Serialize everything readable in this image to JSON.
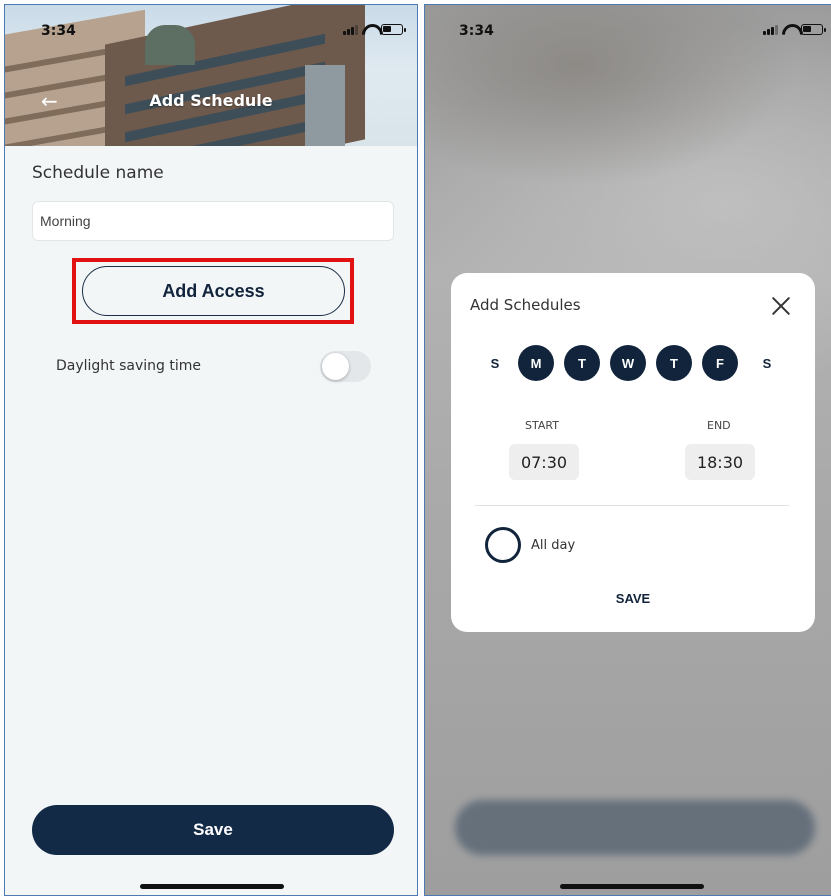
{
  "left": {
    "status": {
      "time": "3:34"
    },
    "header": {
      "title": "Add Schedule"
    },
    "schedule_name": {
      "label": "Schedule name",
      "value": "Morning"
    },
    "add_access": {
      "label": "Add Access"
    },
    "dst": {
      "label": "Daylight saving time",
      "enabled": false
    },
    "save": {
      "label": "Save"
    }
  },
  "right": {
    "status": {
      "time": "3:34"
    },
    "modal": {
      "title": "Add Schedules",
      "days": [
        {
          "label": "S",
          "selected": false
        },
        {
          "label": "M",
          "selected": true
        },
        {
          "label": "T",
          "selected": true
        },
        {
          "label": "W",
          "selected": true
        },
        {
          "label": "T",
          "selected": true
        },
        {
          "label": "F",
          "selected": true
        },
        {
          "label": "S",
          "selected": false
        }
      ],
      "start": {
        "label": "START",
        "value": "07:30"
      },
      "end": {
        "label": "END",
        "value": "18:30"
      },
      "all_day": {
        "label": "All day",
        "checked": false
      },
      "save_label": "SAVE"
    }
  },
  "colors": {
    "primary": "#12243c",
    "highlight": "#e31212",
    "background": "#f2f6f7"
  },
  "icons": [
    "back-arrow-icon",
    "signal-icon",
    "wifi-icon",
    "battery-icon",
    "close-icon"
  ]
}
